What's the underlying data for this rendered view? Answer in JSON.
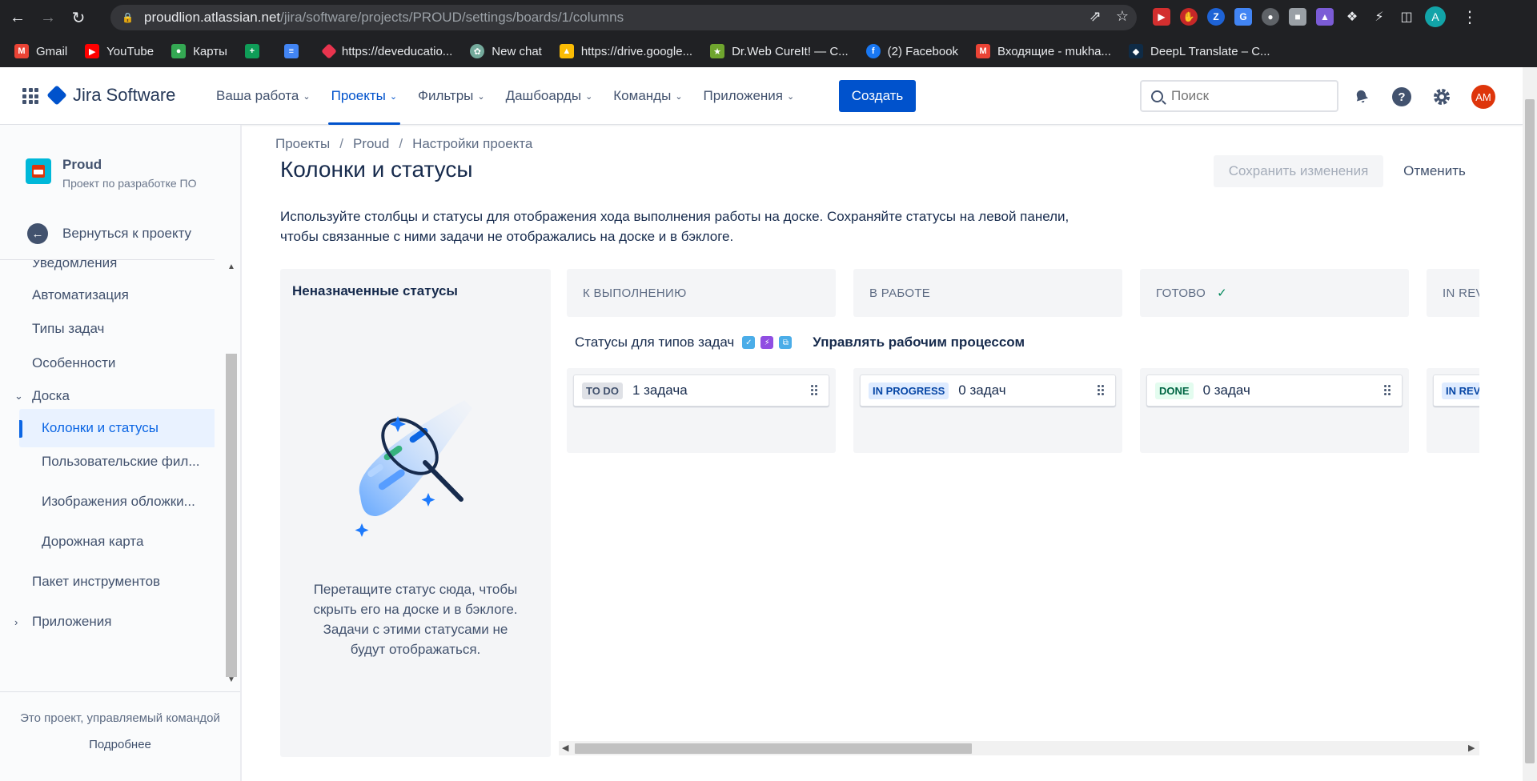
{
  "browser": {
    "url_host": "proudlion.atlassian.net",
    "url_path": "/jira/software/projects/PROUD/settings/boards/1/columns",
    "profile_initial": "A",
    "bookmarks": [
      {
        "label": "Gmail",
        "icon": "gmail-icon",
        "color": "#ea4335"
      },
      {
        "label": "YouTube",
        "icon": "youtube-icon",
        "color": "#ff0000"
      },
      {
        "label": "Карты",
        "icon": "maps-icon",
        "color": "#34a853"
      },
      {
        "label": "",
        "icon": "sheets-icon",
        "color": "#0f9d58"
      },
      {
        "label": "",
        "icon": "docs-icon",
        "color": "#4285f4"
      },
      {
        "label": "https://deveducatio...",
        "icon": "deveducation-icon",
        "color": "#e8344e"
      },
      {
        "label": "New chat",
        "icon": "chatgpt-icon",
        "color": "#74aa9c"
      },
      {
        "label": "https://drive.google...",
        "icon": "drive-icon",
        "color": "#fbbc04"
      },
      {
        "label": "Dr.Web CureIt! — C...",
        "icon": "drweb-icon",
        "color": "#6fa52e"
      },
      {
        "label": "(2) Facebook",
        "icon": "facebook-icon",
        "color": "#1877f2"
      },
      {
        "label": "Входящие - mukha...",
        "icon": "gmail-icon",
        "color": "#ea4335"
      },
      {
        "label": "DeepL Translate – C...",
        "icon": "deepl-icon",
        "color": "#0f2b46"
      }
    ]
  },
  "topnav": {
    "product": "Jira Software",
    "items": [
      {
        "label": "Ваша работа",
        "active": false
      },
      {
        "label": "Проекты",
        "active": true
      },
      {
        "label": "Фильтры",
        "active": false
      },
      {
        "label": "Дашбоарды",
        "active": false
      },
      {
        "label": "Команды",
        "active": false
      },
      {
        "label": "Приложения",
        "active": false
      }
    ],
    "create_label": "Создать",
    "search_placeholder": "Поиск",
    "avatar_initials": "AM",
    "accent": "#0052cc"
  },
  "sidebar": {
    "project_name": "Proud",
    "project_sub": "Проект по разработке ПО",
    "back_label": "Вернуться к проекту",
    "items": [
      {
        "label": "Уведомления"
      },
      {
        "label": "Автоматизация"
      },
      {
        "label": "Типы задач"
      },
      {
        "label": "Особенности"
      },
      {
        "label": "Доска"
      },
      {
        "label": "Колонки и статусы"
      },
      {
        "label": "Пользовательские фил..."
      },
      {
        "label": "Изображения обложки..."
      },
      {
        "label": "Дорожная карта"
      },
      {
        "label": "Пакет инструментов"
      },
      {
        "label": "Приложения"
      }
    ],
    "footer_text": "Это проект, управляемый командой",
    "footer_link": "Подробнее"
  },
  "main": {
    "breadcrumbs": [
      "Проекты",
      "Proud",
      "Настройки проекта"
    ],
    "title": "Колонки и статусы",
    "save_label": "Сохранить изменения",
    "cancel_label": "Отменить",
    "description": "Используйте столбцы и статусы для отображения хода выполнения работы на доске. Сохраняйте статусы на левой панели, чтобы связанные с ними задачи не отображались на доске и в бэклоге.",
    "unassigned": {
      "title": "Неназначенные статусы",
      "hint": "Перетащите статус сюда, чтобы скрыть его на доске и в бэклоге. Задачи с этими статусами не будут отображаться."
    },
    "workflow": {
      "label": "Статусы для типов задач",
      "manage": "Управлять рабочим процессом"
    },
    "columns": [
      {
        "name": "К ВЫПОЛНЕНИЮ",
        "status": "TO DO",
        "count": "1 задача",
        "done": false
      },
      {
        "name": "В РАБОТЕ",
        "status": "IN PROGRESS",
        "count": "0 задач",
        "done": false
      },
      {
        "name": "ГОТОВО",
        "status": "DONE",
        "count": "0 задач",
        "done": true
      },
      {
        "name": "IN REV",
        "status": "IN REV",
        "count": "",
        "done": false
      }
    ]
  }
}
